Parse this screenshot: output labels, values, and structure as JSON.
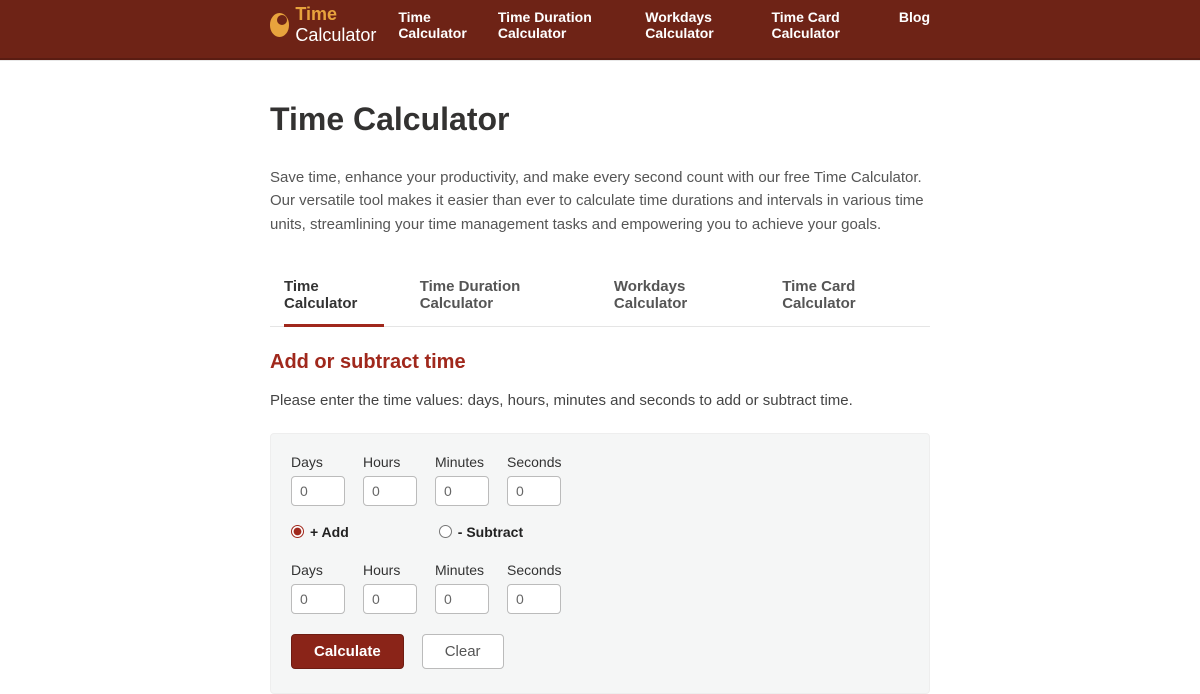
{
  "brand": {
    "part1": "Time",
    "part2": "Calculator"
  },
  "nav": {
    "items": [
      "Time Calculator",
      "Time Duration Calculator",
      "Workdays Calculator",
      "Time Card Calculator",
      "Blog"
    ]
  },
  "page": {
    "title": "Time Calculator",
    "intro": "Save time, enhance your productivity, and make every second count with our free Time Calculator. Our versatile tool makes it easier than ever to calculate time durations and intervals in various time units, streamlining your time management tasks and empowering you to achieve your goals."
  },
  "tabs": {
    "items": [
      "Time Calculator",
      "Time Duration Calculator",
      "Workdays Calculator",
      "Time Card Calculator"
    ],
    "activeIndex": 0
  },
  "form": {
    "heading": "Add or subtract time",
    "instruction": "Please enter the time values: days, hours, minutes and seconds to add or subtract time.",
    "labels": {
      "days": "Days",
      "hours": "Hours",
      "minutes": "Minutes",
      "seconds": "Seconds"
    },
    "row1": {
      "days": "0",
      "hours": "0",
      "minutes": "0",
      "seconds": "0"
    },
    "row2": {
      "days": "0",
      "hours": "0",
      "minutes": "0",
      "seconds": "0"
    },
    "operation": {
      "add": "+ Add",
      "subtract": "- Subtract",
      "selected": "add"
    },
    "buttons": {
      "calculate": "Calculate",
      "clear": "Clear"
    }
  }
}
